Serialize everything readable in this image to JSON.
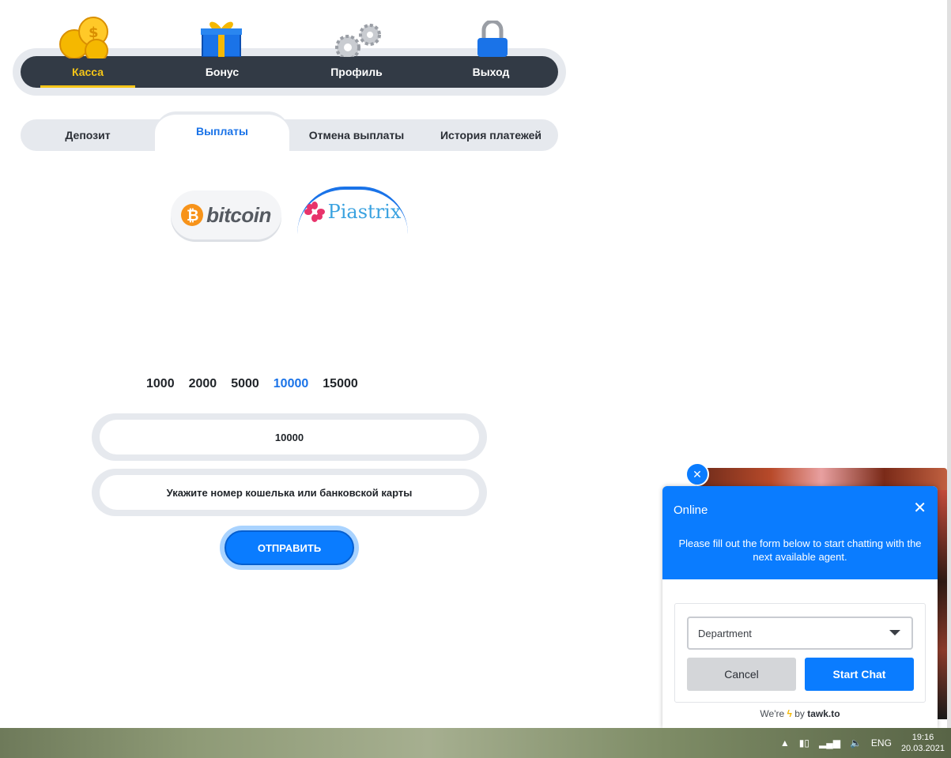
{
  "nav": {
    "items": [
      {
        "label": "Касса",
        "icon": "coins-icon",
        "active": true
      },
      {
        "label": "Бонус",
        "icon": "gift-icon",
        "active": false
      },
      {
        "label": "Профиль",
        "icon": "gears-icon",
        "active": false
      },
      {
        "label": "Выход",
        "icon": "padlock-icon",
        "active": false
      }
    ]
  },
  "tabs": [
    {
      "label": "Депозит"
    },
    {
      "label": "Выплаты"
    },
    {
      "label": "Отмена выплаты"
    },
    {
      "label": "История платежей"
    }
  ],
  "methods": {
    "bitcoin": "bitcoin",
    "piastrix": "Piastrix"
  },
  "amounts": [
    "1000",
    "2000",
    "5000",
    "10000",
    "15000"
  ],
  "form": {
    "amount_value": "10000",
    "wallet_placeholder": "Укажите номер кошелька или банковской карты",
    "submit_label": "ОТПРАВИТЬ"
  },
  "chat": {
    "status": "Online",
    "message": "Please fill out the form below to start chatting with the next available agent.",
    "department_placeholder": "Department",
    "cancel_label": "Cancel",
    "start_label": "Start Chat",
    "footer_prefix": "We're",
    "footer_by": "by",
    "footer_brand": "tawk.to"
  },
  "taskbar": {
    "lang": "ENG",
    "time": "19:16",
    "date": "20.03.2021"
  },
  "colors": {
    "accent_blue": "#0a7cff",
    "nav_dark": "#323a45",
    "active_yellow": "#f5c518"
  }
}
